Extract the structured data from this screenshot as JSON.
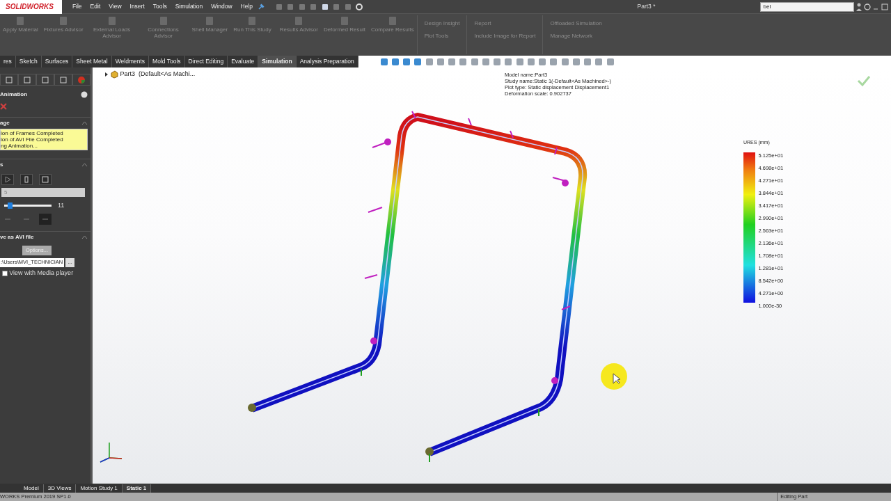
{
  "app": {
    "logo": "SOLIDWORKS",
    "menu": [
      "File",
      "Edit",
      "View",
      "Insert",
      "Tools",
      "Simulation",
      "Window",
      "Help"
    ],
    "title": "Part3 *",
    "search": {
      "value": "bel"
    }
  },
  "ribbon": {
    "large": [
      "Apply Material",
      "Fixtures Advisor",
      "External Loads Advisor",
      "Connections Advisor",
      "Shell Manager",
      "Run This Study",
      "Results Advisor",
      "Deformed Result",
      "Compare Results"
    ],
    "small": [
      [
        "Design Insight",
        "Plot Tools"
      ],
      [
        "Report",
        "Include Image for Report"
      ],
      [
        "Offloaded Simulation",
        "Manage Network"
      ]
    ]
  },
  "tabs": [
    {
      "label": "res",
      "selected": false
    },
    {
      "label": "Sketch",
      "selected": false
    },
    {
      "label": "Surfaces",
      "selected": false
    },
    {
      "label": "Sheet Metal",
      "selected": false
    },
    {
      "label": "Weldments",
      "selected": false
    },
    {
      "label": "Mold Tools",
      "selected": false
    },
    {
      "label": "Direct Editing",
      "selected": false
    },
    {
      "label": "Evaluate",
      "selected": false
    },
    {
      "label": "Simulation",
      "selected": true
    },
    {
      "label": "Analysis Preparation",
      "selected": false
    }
  ],
  "panel": {
    "title": "Animation",
    "message": {
      "header": "age",
      "lines": [
        "ion of Frames Completed",
        "ion of AVI File Completed",
        "ng Animation..."
      ]
    },
    "controls": {
      "header": "s",
      "frames": "5",
      "slider": {
        "level": 0.08,
        "reading": "11"
      }
    },
    "save": {
      "header": "ve as AVI file",
      "options": "Options...",
      "path": ":\\Users\\MVI_TECHNICIAN",
      "browse": "...",
      "checkbox": {
        "label": "View with Media player",
        "checked": false
      }
    }
  },
  "tree": {
    "label": "Part3  (Default<As Machi..."
  },
  "plot_info": [
    "Model name:Part3",
    "Study name:Static 1(-Default<As Machined>-)",
    "Plot type: Static displacement Displacement1",
    "Deformation scale: 0.902737"
  ],
  "legend": {
    "title": "URES (mm)",
    "labels": [
      "5.125e+01",
      "4.698e+01",
      "4.271e+01",
      "3.844e+01",
      "3.417e+01",
      "2.990e+01",
      "2.563e+01",
      "2.136e+01",
      "1.708e+01",
      "1.281e+01",
      "8.542e+00",
      "4.271e+00",
      "1.000e-30"
    ]
  },
  "bottom_tabs": [
    {
      "label": "Model",
      "selected": false
    },
    {
      "label": "3D Views",
      "selected": false
    },
    {
      "label": "Motion Study 1",
      "selected": false
    },
    {
      "label": "Static 1",
      "selected": true
    }
  ],
  "status_bar": {
    "left": "WORKS Premium 2019 SP1.0",
    "right": "Editing Part"
  }
}
